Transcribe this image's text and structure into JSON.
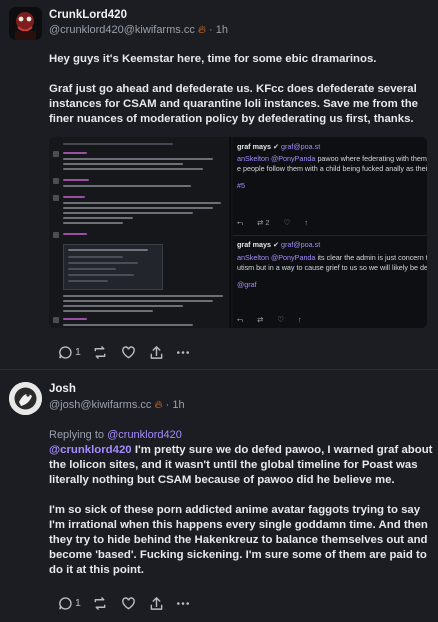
{
  "post1": {
    "display_name": "CrunkLord420",
    "handle": "@crunklord420@kiwifarms.cc",
    "time": "1h",
    "paragraphs": [
      "Hey guys it's Keemstar here, time for some ebic dramarinos.",
      "Graf just go ahead and defederate us. KFcc does defederate several instances for CSAM and quarantine loli instances. Save me from the finer nuances of moderation policy by defederating us first, thanks."
    ],
    "attachment": {
      "right_top": {
        "display_name": "graf mays",
        "handle": "graf@poa.st",
        "line1_prefix": "anSkelton",
        "line1_mention": "@PonyPanda",
        "line1_text": "pawoo where federating with them m",
        "line2": "e people follow them with a child being fucked anally as their p",
        "tag": "#5"
      },
      "right_bottom": {
        "display_name": "graf mays",
        "handle": "graf@poa.st",
        "line1_prefix": "anSkelton",
        "line1_mention": "@PonyPanda",
        "line1_text": "its clear the admin is just concern tro",
        "line2": "utism but in a way to cause grief to us so we will likely be def",
        "tag": "@graf"
      },
      "right_actions_top": {
        "boosts": "2"
      },
      "right_actions_bottom": {
        "boosts": ""
      }
    },
    "actions": {
      "replies": "1",
      "boosts": "",
      "likes": ""
    }
  },
  "post2": {
    "display_name": "Josh",
    "handle": "@josh@kiwifarms.cc",
    "time": "1h",
    "replying_label": "Replying to",
    "replying_to": "@crunklord420",
    "mention": "@crunklord420",
    "paragraph1_rest": " I'm pretty sure we do defed pawoo, I warned graf about the lolicon sites, and it wasn't until the global timeline for Poast was literally nothing but CSAM because of pawoo did he believe me.",
    "paragraph2": "I'm so sick of these porn addicted anime avatar faggots trying to say I'm irrational when this happens every single goddamn time. And then they try to hide behind the Hakenkreuz to balance themselves out and become 'based'. Fucking sickening. I'm sure some of them are paid to do it at this point.",
    "actions": {
      "replies": "1",
      "boosts": "",
      "likes": ""
    }
  },
  "colors": {
    "background": "#1b1d22",
    "accent": "#a58cff",
    "fire": "#ff7a1a"
  }
}
